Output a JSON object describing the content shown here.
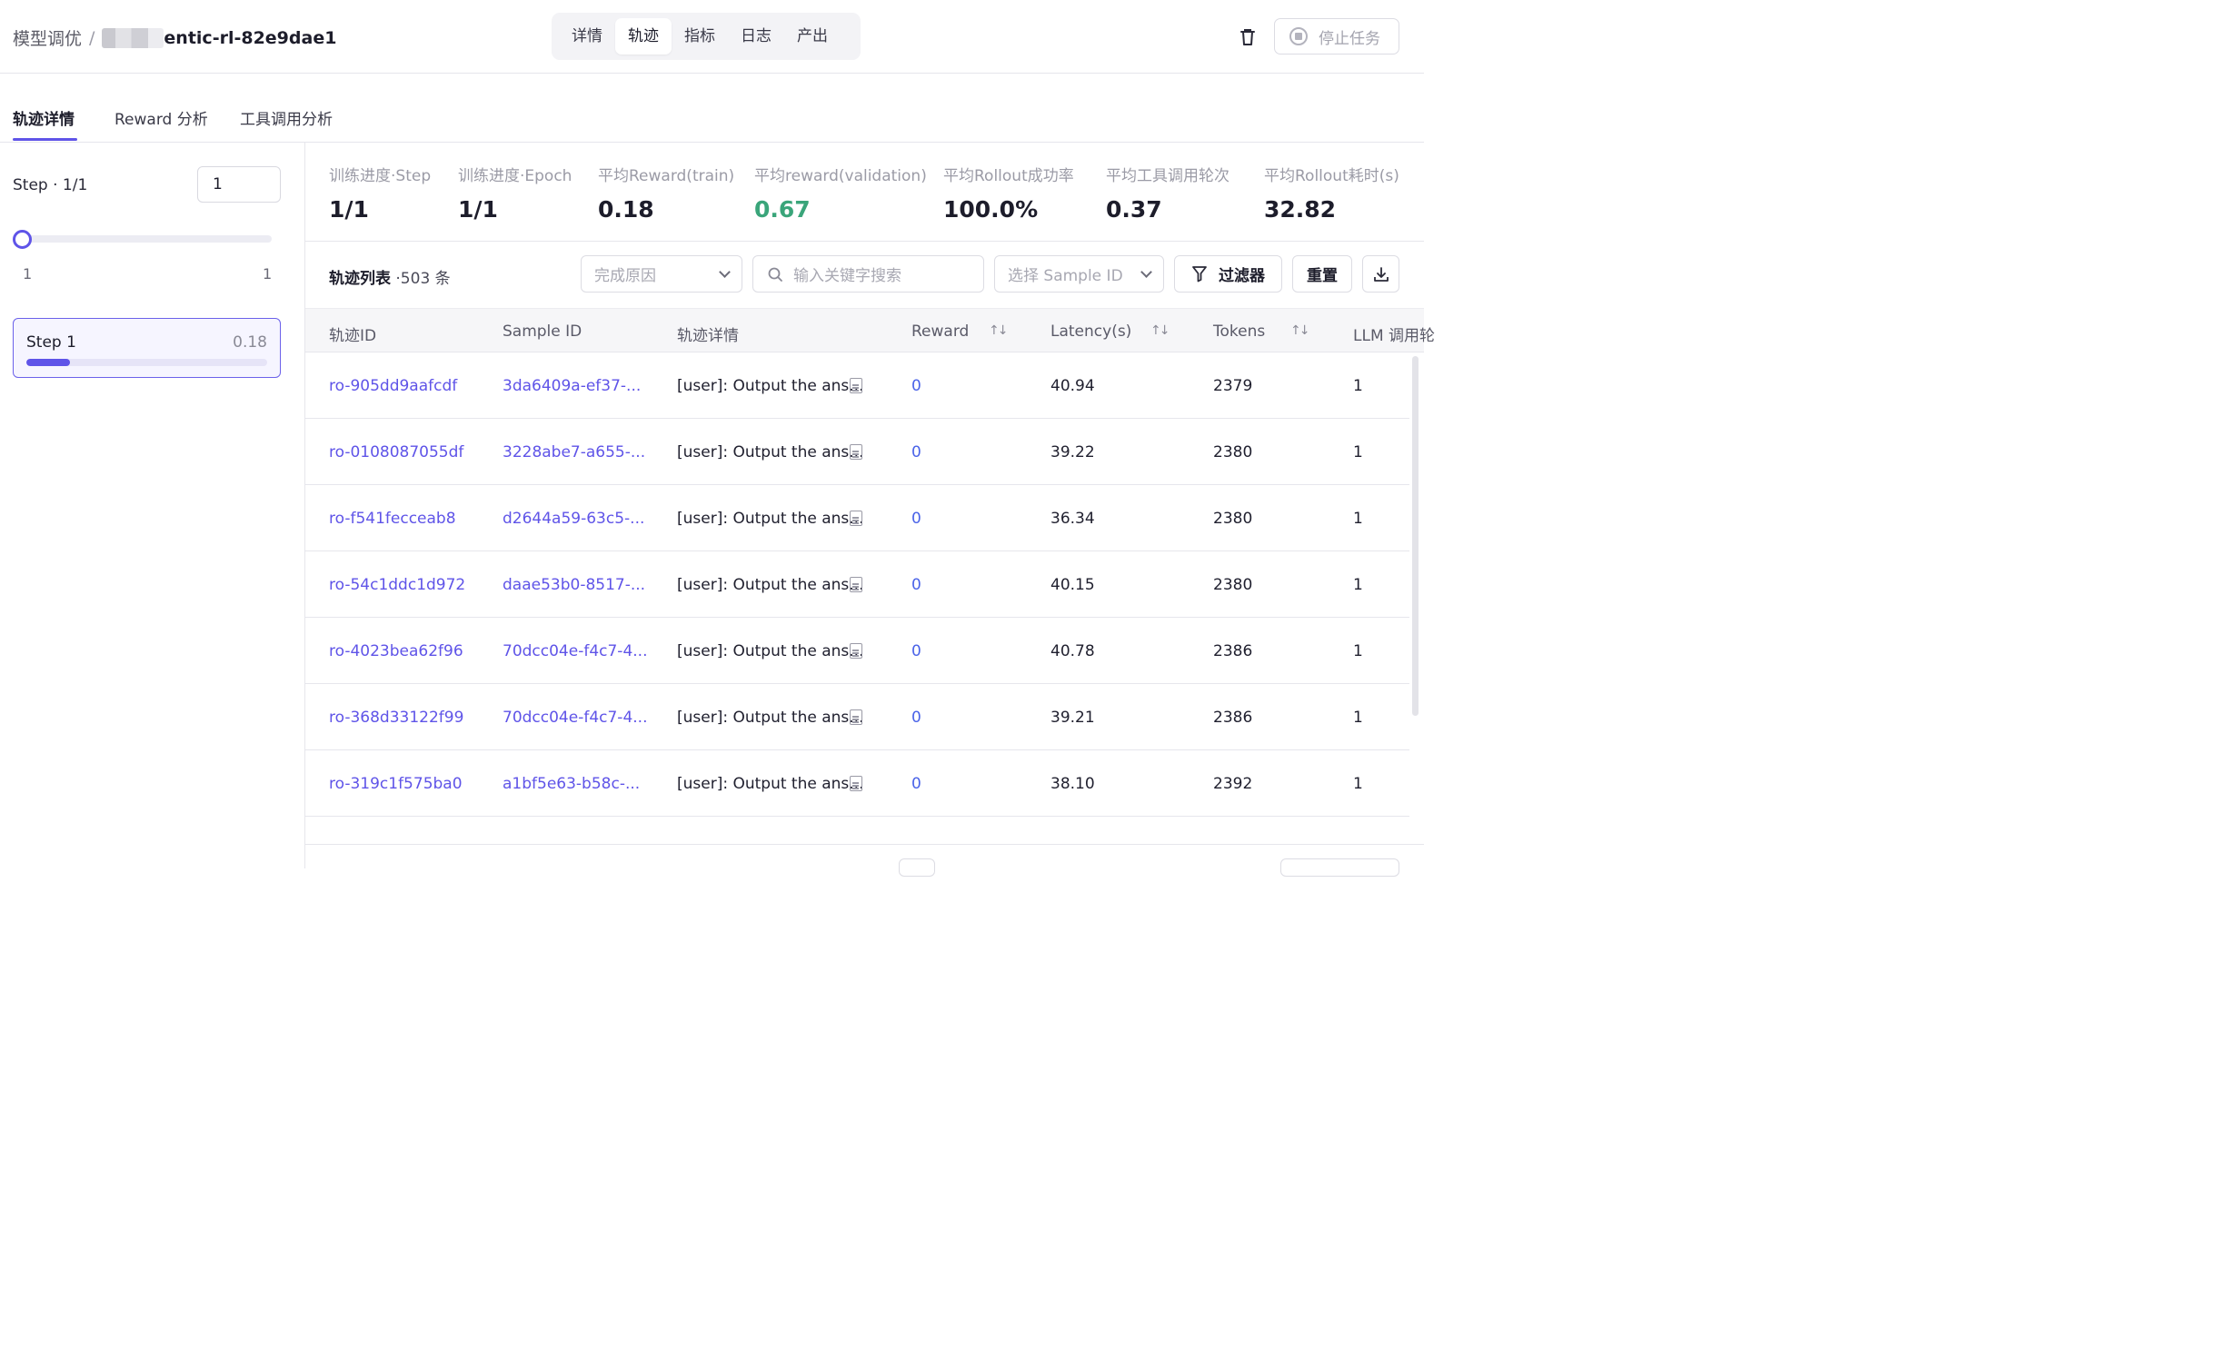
{
  "header": {
    "breadcrumb_root": "模型调优",
    "breadcrumb_sep": "/",
    "breadcrumb_current": "entic-rl-82e9dae1",
    "tabs": [
      "详情",
      "轨迹",
      "指标",
      "日志",
      "产出"
    ],
    "active_tab": "轨迹",
    "stop_label": "停止任务"
  },
  "subtabs": {
    "items": [
      "轨迹详情",
      "Reward 分析",
      "工具调用分析"
    ],
    "active": "轨迹详情"
  },
  "left": {
    "step_label": "Step · 1/1",
    "step_input_value": "1",
    "slider_min": "1",
    "slider_max": "1",
    "slider_value": 1,
    "step_card": {
      "name": "Step 1",
      "value": "0.18",
      "progress": 0.18
    }
  },
  "metrics": [
    {
      "label": "训练进度·Step",
      "value": "1/1"
    },
    {
      "label": "训练进度·Epoch",
      "value": "1/1"
    },
    {
      "label": "平均Reward(train)",
      "value": "0.18"
    },
    {
      "label": "平均reward(validation)",
      "value": "0.67",
      "color": "#3aa57a"
    },
    {
      "label": "平均Rollout成功率",
      "value": "100.0%"
    },
    {
      "label": "平均工具调用轮次",
      "value": "0.37"
    },
    {
      "label": "平均Rollout耗时(s)",
      "value": "32.82"
    }
  ],
  "toolbar": {
    "title": "轨迹列表",
    "count": " ·503 条",
    "finish_reason_placeholder": "完成原因",
    "search_placeholder": "输入关键字搜索",
    "sample_placeholder": "选择 Sample ID",
    "filter_label": "过滤器",
    "reset_label": "重置"
  },
  "table": {
    "columns": [
      "轨迹ID",
      "Sample ID",
      "轨迹详情",
      "Reward",
      "Latency(s)",
      "Tokens",
      "LLM 调用轮"
    ],
    "rows": [
      {
        "id": "ro-905dd9aafcdf",
        "sample": "3da6409a-ef37-...",
        "detail": "[user]: Output the ans...",
        "reward": "0",
        "latency": "40.94",
        "tokens": "2379",
        "llm": "1"
      },
      {
        "id": "ro-0108087055df",
        "sample": "3228abe7-a655-...",
        "detail": "[user]: Output the ans...",
        "reward": "0",
        "latency": "39.22",
        "tokens": "2380",
        "llm": "1"
      },
      {
        "id": "ro-f541fecceab8",
        "sample": "d2644a59-63c5-...",
        "detail": "[user]: Output the ans...",
        "reward": "0",
        "latency": "36.34",
        "tokens": "2380",
        "llm": "1"
      },
      {
        "id": "ro-54c1ddc1d972",
        "sample": "daae53b0-8517-...",
        "detail": "[user]: Output the ans...",
        "reward": "0",
        "latency": "40.15",
        "tokens": "2380",
        "llm": "1"
      },
      {
        "id": "ro-4023bea62f96",
        "sample": "70dcc04e-f4c7-4...",
        "detail": "[user]: Output the ans...",
        "reward": "0",
        "latency": "40.78",
        "tokens": "2386",
        "llm": "1"
      },
      {
        "id": "ro-368d33122f99",
        "sample": "70dcc04e-f4c7-4...",
        "detail": "[user]: Output the ans...",
        "reward": "0",
        "latency": "39.21",
        "tokens": "2386",
        "llm": "1"
      },
      {
        "id": "ro-319c1f575ba0",
        "sample": "a1bf5e63-b58c-...",
        "detail": "[user]: Output the ans...",
        "reward": "0",
        "latency": "38.10",
        "tokens": "2392",
        "llm": "1"
      }
    ]
  },
  "colors": {
    "accent": "#5f54e8",
    "link": "#5f54e8",
    "reward_link": "#4a63e8",
    "green": "#3aa57a"
  }
}
